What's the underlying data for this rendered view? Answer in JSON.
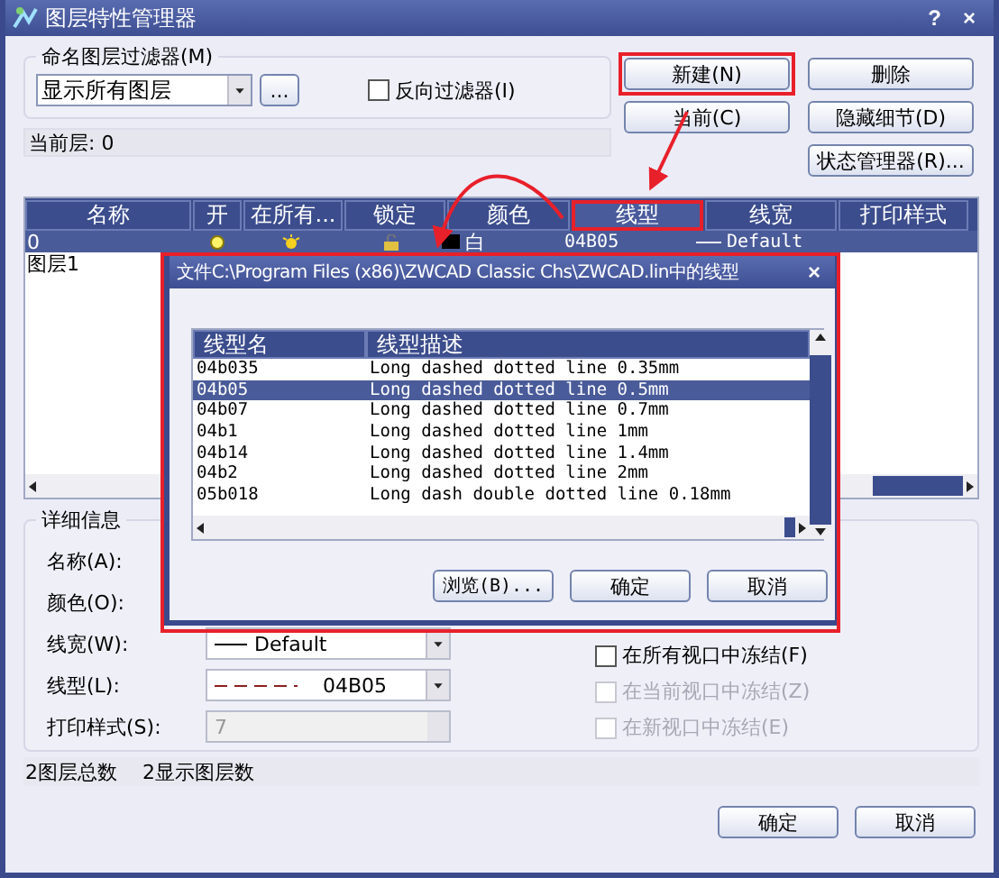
{
  "window": {
    "title": "图层特性管理器",
    "help": "?",
    "close": "×"
  },
  "filter": {
    "legend": "命名图层过滤器(M)",
    "value": "显示所有图层",
    "browse": "...",
    "invert": {
      "label": "反向过滤器(I)",
      "checked": false
    }
  },
  "buttons": [
    {
      "label": "新建(N)",
      "highlighted": true
    },
    {
      "label": "删除",
      "highlighted": false
    },
    {
      "label": "当前(C)",
      "highlighted": false
    },
    {
      "label": "隐藏细节(D)",
      "highlighted": false
    },
    {
      "label": "状态管理器(R)...",
      "highlighted": false
    }
  ],
  "current_layer": "当前层: 0",
  "table": {
    "columns": [
      {
        "label": "名称",
        "highlighted": false
      },
      {
        "label": "开",
        "highlighted": false
      },
      {
        "label": "在所有...",
        "highlighted": false
      },
      {
        "label": "锁定",
        "highlighted": false
      },
      {
        "label": "颜色",
        "highlighted": false
      },
      {
        "label": "线型",
        "highlighted": true
      },
      {
        "label": "线宽",
        "highlighted": false
      },
      {
        "label": "打印样式",
        "highlighted": false
      }
    ],
    "rows": [
      {
        "name": "0",
        "selected": true,
        "color_name": "白",
        "linetype": "04B05",
        "lineweight": "Default"
      },
      {
        "name": "图层1",
        "selected": false
      }
    ]
  },
  "details": {
    "legend": "详细信息",
    "fields": [
      {
        "label": "名称(A):",
        "kind": "hidden"
      },
      {
        "label": "颜色(O):",
        "kind": "hidden"
      },
      {
        "label": "线宽(W):",
        "kind": "lineweight",
        "value": "Default"
      },
      {
        "label": "线型(L):",
        "kind": "linetype",
        "value": "04B05"
      },
      {
        "label": "打印样式(S):",
        "kind": "readonly",
        "value": "7"
      }
    ],
    "checks": [
      {
        "label": "在所有视口中冻结(F)",
        "checked": false,
        "disabled": false
      },
      {
        "label": "在当前视口中冻结(Z)",
        "checked": false,
        "disabled": true
      },
      {
        "label": "在新视口中冻结(E)",
        "checked": false,
        "disabled": true
      }
    ]
  },
  "status": [
    "2图层总数",
    "2显示图层数"
  ],
  "footer_buttons": [
    "确定",
    "取消"
  ],
  "modal": {
    "title": "文件C:\\Program Files (x86)\\ZWCAD Classic Chs\\ZWCAD.lin中的线型",
    "close": "×",
    "columns": [
      "线型名",
      "线型描述"
    ],
    "rows": [
      {
        "name": "04b035",
        "description": "Long dashed dotted line 0.35mm",
        "selected": false
      },
      {
        "name": "04b05",
        "description": "Long dashed dotted line 0.5mm",
        "selected": true
      },
      {
        "name": "04b07",
        "description": "Long dashed dotted line 0.7mm",
        "selected": false
      },
      {
        "name": "04b1",
        "description": "Long dashed dotted line 1mm",
        "selected": false
      },
      {
        "name": "04b14",
        "description": "Long dashed dotted line 1.4mm",
        "selected": false
      },
      {
        "name": "04b2",
        "description": "Long dashed dotted line 2mm",
        "selected": false
      },
      {
        "name": "05b018",
        "description": "Long dash double dotted line 0.18mm",
        "selected": false
      }
    ],
    "buttons": [
      "浏览(B)...",
      "确定",
      "取消"
    ]
  }
}
